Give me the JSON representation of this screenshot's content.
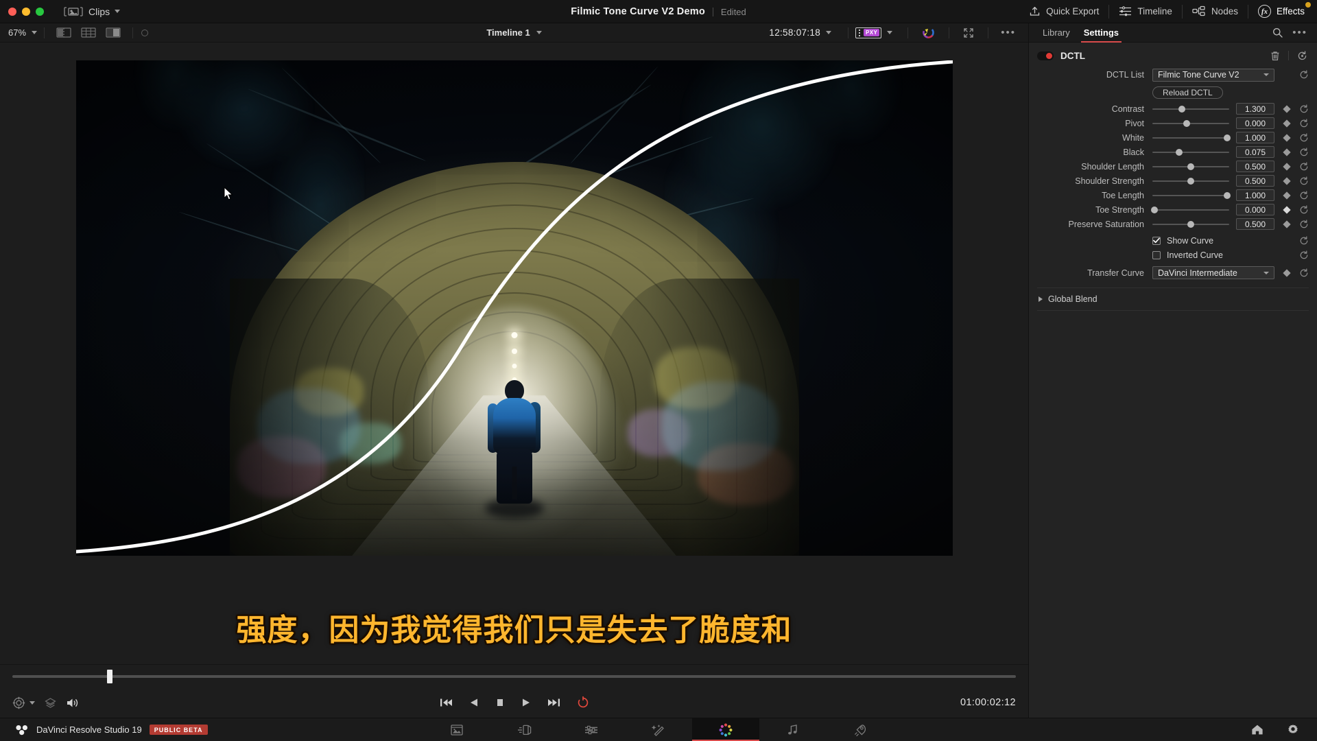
{
  "titlebar": {
    "clips_menu": "Clips",
    "project_title": "Filmic Tone Curve V2 Demo",
    "project_state": "Edited",
    "buttons": [
      {
        "label": "Quick Export",
        "icon": "export-icon"
      },
      {
        "label": "Timeline",
        "icon": "timeline-icon"
      },
      {
        "label": "Nodes",
        "icon": "nodes-icon"
      },
      {
        "label": "Effects",
        "icon": "fx-icon"
      }
    ]
  },
  "viewer_toolbar": {
    "zoom_level": "67%",
    "timeline_name": "Timeline 1",
    "timecode": "12:58:07:18",
    "proxy_badge": "PXY",
    "icons": [
      "split-screen-icon",
      "grid-view-icon",
      "wipe-icon",
      "color-wheel-icon",
      "fullscreen-icon",
      "more-options-icon"
    ]
  },
  "viewer": {
    "subtitle_text": "强度，因为我觉得我们只是失去了脆度和",
    "subtitle_color": "#ffb62e",
    "curve_overlay_color": "#ffffff",
    "scrubber_position_pct": 9.4,
    "end_timecode": "01:00:02:12",
    "transport_icons": [
      "jump-to-start-icon",
      "step-back-icon",
      "stop-icon",
      "play-icon",
      "jump-to-end-icon",
      "loop-icon"
    ],
    "left_icons": [
      "color-target-icon",
      "layers-icon",
      "audio-volume-icon"
    ]
  },
  "inspector": {
    "tabs": [
      {
        "label": "Library",
        "active": false
      },
      {
        "label": "Settings",
        "active": true
      }
    ],
    "tab_icons": [
      "search-icon",
      "more-options-icon"
    ],
    "effect": {
      "name": "DCTL",
      "enabled": true,
      "accent_color": "#e03a35",
      "header_icons": [
        "trash-icon",
        "reset-all-icon"
      ]
    },
    "dctl_list": {
      "label": "DCTL List",
      "value": "Filmic Tone Curve V2"
    },
    "reload_button": "Reload DCTL",
    "parameters": [
      {
        "label": "Contrast",
        "value": "1.300",
        "slider_pct": 38,
        "keyframe_lit": false
      },
      {
        "label": "Pivot",
        "value": "0.000",
        "slider_pct": 45,
        "keyframe_lit": false
      },
      {
        "label": "White",
        "value": "1.000",
        "slider_pct": 97,
        "keyframe_lit": false
      },
      {
        "label": "Black",
        "value": "0.075",
        "slider_pct": 35,
        "keyframe_lit": false
      },
      {
        "label": "Shoulder Length",
        "value": "0.500",
        "slider_pct": 50,
        "keyframe_lit": false
      },
      {
        "label": "Shoulder Strength",
        "value": "0.500",
        "slider_pct": 50,
        "keyframe_lit": false
      },
      {
        "label": "Toe Length",
        "value": "1.000",
        "slider_pct": 97,
        "keyframe_lit": false
      },
      {
        "label": "Toe Strength",
        "value": "0.000",
        "slider_pct": 3,
        "keyframe_lit": true
      },
      {
        "label": "Preserve Saturation",
        "value": "0.500",
        "slider_pct": 50,
        "keyframe_lit": false
      }
    ],
    "checkboxes": [
      {
        "label": "Show Curve",
        "checked": true
      },
      {
        "label": "Inverted Curve",
        "checked": false
      }
    ],
    "transfer_curve": {
      "label": "Transfer Curve",
      "value": "DaVinci Intermediate"
    },
    "global_blend": "Global Blend"
  },
  "statusbar": {
    "app_name": "DaVinci Resolve Studio 19",
    "badge": "PUBLIC BETA",
    "pages": [
      {
        "name": "media",
        "icon": "media-page-icon",
        "active": false
      },
      {
        "name": "cut",
        "icon": "cut-page-icon",
        "active": false
      },
      {
        "name": "edit",
        "icon": "edit-page-icon",
        "active": false
      },
      {
        "name": "fusion",
        "icon": "fusion-page-icon",
        "active": false
      },
      {
        "name": "color",
        "icon": "color-page-icon",
        "active": true
      },
      {
        "name": "fairlight",
        "icon": "fairlight-page-icon",
        "active": false
      },
      {
        "name": "deliver",
        "icon": "deliver-page-icon",
        "active": false
      }
    ],
    "right_icons": [
      "home-icon",
      "settings-gear-icon"
    ]
  }
}
